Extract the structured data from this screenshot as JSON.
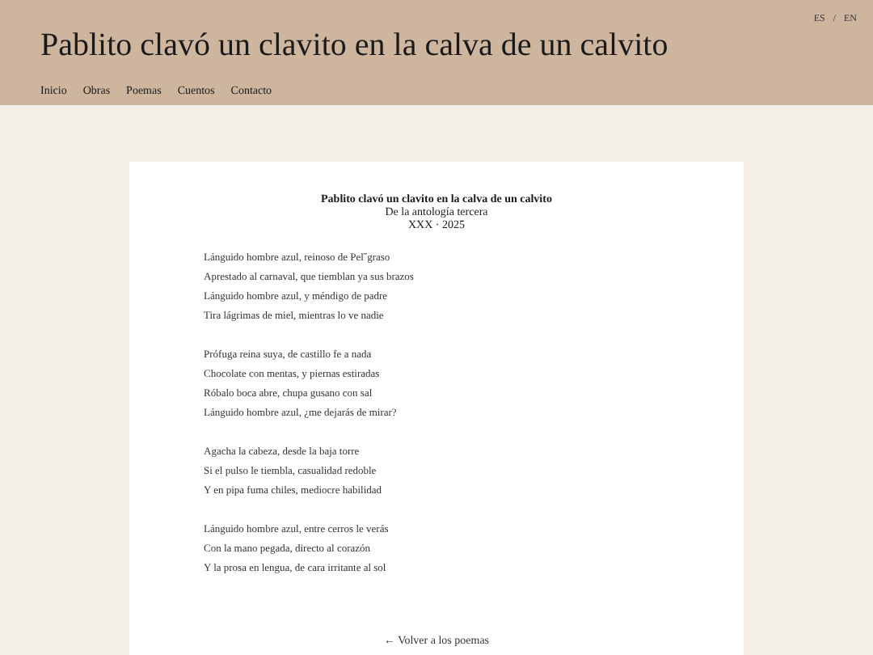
{
  "header": {
    "title": "Pablito clavó un clavito en la calva de un calvito",
    "nav": [
      "Inicio",
      "Obras",
      "Poemas",
      "Cuentos",
      "Contacto"
    ],
    "languages": [
      "ES",
      "EN"
    ],
    "language_separator": "/"
  },
  "poem": {
    "title": "Pablito clavó un clavito en la calva de un calvito",
    "subtitle": "De la antología tercera",
    "meta": "XXX · 2025",
    "stanzas": [
      [
        "Lánguido hombre azul, reinoso de Pel˝graso",
        "Aprestado al carnaval, que tiemblan ya sus brazos",
        "Lánguido hombre azul, y méndigo de padre",
        "Tira lágrimas de miel, mientras lo ve nadie"
      ],
      [
        "Prófuga reina suya, de castillo fe a nada",
        "Chocolate con mentas, y piernas estiradas",
        "Róbalo boca abre, chupa gusano con sal",
        "Lánguido hombre azul, ¿me dejarás de mirar?"
      ],
      [
        "Agacha la cabeza, desde la baja torre",
        "Si el pulso le tiembla, casualidad redoble",
        "Y en pipa fuma chiles, mediocre habilidad"
      ],
      [
        "Lánguido hombre azul, entre cerros le verás",
        "Con la mano pegada, directo al corazón",
        "Y la prosa en lengua, de cara irritante al sol"
      ]
    ],
    "back_link": "← Volver a los poemas"
  }
}
